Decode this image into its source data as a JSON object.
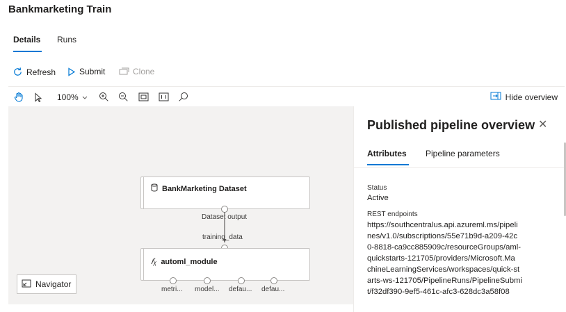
{
  "page": {
    "title": "Bankmarketing Train"
  },
  "tabs": [
    {
      "label": "Details"
    },
    {
      "label": "Runs"
    }
  ],
  "commands": {
    "refresh": "Refresh",
    "submit": "Submit",
    "clone": "Clone"
  },
  "toolbar": {
    "zoom": "100%",
    "hide_overview": "Hide overview"
  },
  "canvas": {
    "dataset_node": {
      "title": "BankMarketing Dataset",
      "output_label": "Dataset output"
    },
    "module_node": {
      "title": "automl_module",
      "input_label": "training_data",
      "outputs": [
        "metri...",
        "model...",
        "defau...",
        "defau..."
      ]
    },
    "navigator": "Navigator"
  },
  "panel": {
    "title": "Published pipeline overview",
    "tabs": [
      {
        "label": "Attributes"
      },
      {
        "label": "Pipeline parameters"
      }
    ],
    "status_label": "Status",
    "status_value": "Active",
    "endpoint_label": "REST endpoints",
    "endpoint_lines": [
      "https://southcentralus.api.azureml.ms/pipeli",
      "nes/v1.0/subscriptions/55e71b9d-a209-42c",
      "0-8818-ca9cc885909c/resourceGroups/aml-",
      "quickstarts-121705/providers/Microsoft.Ma",
      "chineLearningServices/workspaces/quick-st",
      "arts-ws-121705/PipelineRuns/PipelineSubmi",
      "t/f32df390-9ef5-461c-afc3-628dc3a58f08"
    ]
  },
  "colors": {
    "accent": "#0078d4",
    "canvas_bg": "#f3f2f1"
  }
}
